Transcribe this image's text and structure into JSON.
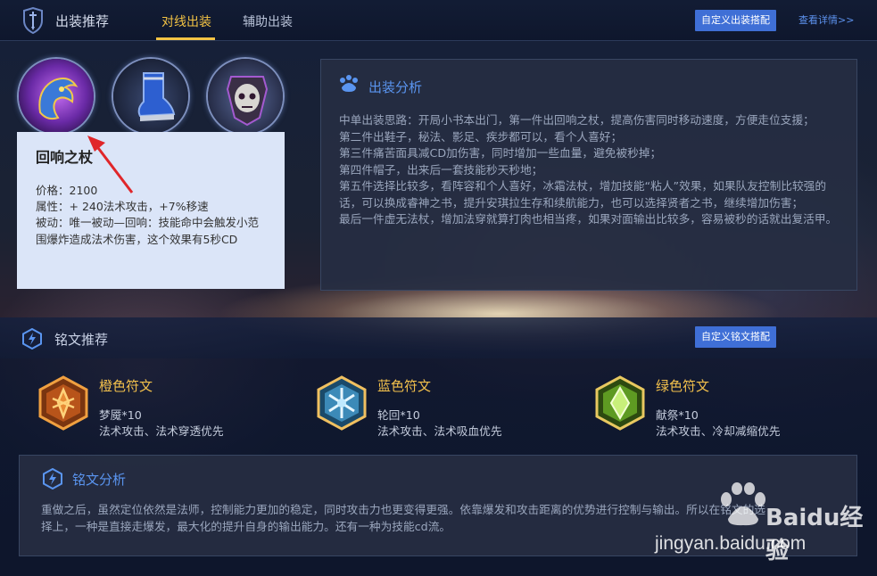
{
  "header": {
    "title": "出装推荐",
    "tabs": [
      {
        "label": "对线出装",
        "active": true
      },
      {
        "label": "辅助出装",
        "active": false
      }
    ],
    "custom_build_button": "自定义出装搭配",
    "details_link": "查看详情>>"
  },
  "item_tooltip": {
    "name": "回响之杖",
    "price": "价格：2100",
    "attributes": "属性：+ 240法术攻击，+7%移速",
    "passive": "被动：唯一被动—回响：技能命中会触发小范围爆炸造成法术伤害，这个效果有5秒CD"
  },
  "build_analysis": {
    "title": "出装分析",
    "lines": [
      "中单出装思路：开局小书本出门，第一件出回响之杖，提高伤害同时移动速度，方便走位支援；",
      "第二件出鞋子，秘法、影足、疾步都可以，看个人喜好；",
      "第三件痛苦面具减CD加伤害，同时增加一些血量，避免被秒掉；",
      "第四件帽子，出来后一套技能秒天秒地；",
      "第五件选择比较多，看阵容和个人喜好，冰霜法杖，增加技能“粘人”效果，如果队友控制比较强的话，可以换成睿神之书，提升安琪拉生存和续航能力，也可以选择贤者之书，继续增加伤害；",
      "最后一件虚无法杖，增加法穿就算打肉也相当疼，如果对面输出比较多，容易被秒的话就出复活甲。"
    ]
  },
  "rune_section": {
    "title": "铭文推荐",
    "custom_button": "自定义铭文搭配",
    "runes": [
      {
        "color_name": "橙色符文",
        "name_count": "梦魇*10",
        "effect": "法术攻击、法术穿透优先",
        "accent": "#e0822a"
      },
      {
        "color_name": "蓝色符文",
        "name_count": "轮回*10",
        "effect": "法术攻击、法术吸血优先",
        "accent": "#4fb6e6"
      },
      {
        "color_name": "绿色符文",
        "name_count": "献祭*10",
        "effect": "法术攻击、冷却减缩优先",
        "accent": "#8fcf3c"
      }
    ]
  },
  "rune_analysis": {
    "title": "铭文分析",
    "lines": [
      "重做之后，虽然定位依然是法师，控制能力更加的稳定，同时攻击力也更变得更强。依靠爆发和攻击距离的优势进行控制与输出。所以在铭文的选",
      "择上，一种是直接走爆发，最大化的提升自身的输出能力。还有一种为技能cd流。"
    ]
  },
  "watermark": {
    "brand": "Baidu经验",
    "url": "jingyan.baidu.com"
  },
  "colors": {
    "accent_gold": "#f3c344",
    "accent_blue": "#5a95f0",
    "button_blue": "#3f6fd6",
    "annotation_red": "#e0262a"
  }
}
